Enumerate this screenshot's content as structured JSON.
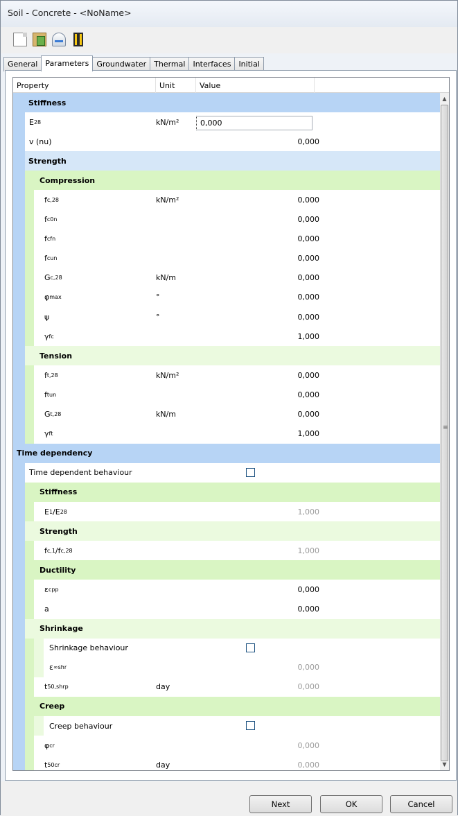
{
  "window": {
    "title": "Soil - Concrete - <NoName>"
  },
  "toolbar": [
    {
      "name": "new-document-icon"
    },
    {
      "name": "paste-icon"
    },
    {
      "name": "database-icon"
    },
    {
      "name": "book-icon"
    }
  ],
  "tabs": [
    {
      "label": "General",
      "active": false
    },
    {
      "label": "Parameters",
      "active": true
    },
    {
      "label": "Groundwater",
      "active": false
    },
    {
      "label": "Thermal",
      "active": false
    },
    {
      "label": "Interfaces",
      "active": false
    },
    {
      "label": "Initial",
      "active": false
    }
  ],
  "grid": {
    "headers": {
      "property": "Property",
      "unit": "Unit",
      "value": "Value"
    },
    "rows": [
      {
        "kind": "group1",
        "label": "Stiffness"
      },
      {
        "kind": "row",
        "level": 1,
        "base": "E",
        "sub": "28",
        "unit": "kN/m²",
        "value": "0,000",
        "edit": true
      },
      {
        "kind": "row",
        "level": 1,
        "base": "v (nu)",
        "value": "0,000"
      },
      {
        "kind": "group1",
        "label": "Strength",
        "light": true
      },
      {
        "kind": "group2",
        "label": "Compression"
      },
      {
        "kind": "row",
        "level": 2,
        "base": "f",
        "sub": "c,28",
        "unit": "kN/m²",
        "value": "0,000"
      },
      {
        "kind": "row",
        "level": 2,
        "base": "f",
        "sub": "c0n",
        "value": "0,000"
      },
      {
        "kind": "row",
        "level": 2,
        "base": "f",
        "sub": "cfn",
        "value": "0,000"
      },
      {
        "kind": "row",
        "level": 2,
        "base": "f",
        "sub": "cun",
        "value": "0,000"
      },
      {
        "kind": "row",
        "level": 2,
        "base": "G",
        "sub": "c,28",
        "unit": "kN/m",
        "value": "0,000"
      },
      {
        "kind": "row",
        "level": 2,
        "base": "φ",
        "sub": "max",
        "unit": "°",
        "value": "0,000"
      },
      {
        "kind": "row",
        "level": 2,
        "base": "ψ",
        "unit": "°",
        "value": "0,000"
      },
      {
        "kind": "row",
        "level": 2,
        "base": "γ",
        "sub": "fc",
        "value": "1,000"
      },
      {
        "kind": "group2",
        "label": "Tension",
        "light": true
      },
      {
        "kind": "row",
        "level": 2,
        "base": "f",
        "sub": "t,28",
        "unit": "kN/m²",
        "value": "0,000"
      },
      {
        "kind": "row",
        "level": 2,
        "base": "f",
        "sub": "tun",
        "value": "0,000"
      },
      {
        "kind": "row",
        "level": 2,
        "base": "G",
        "sub": "t,28",
        "unit": "kN/m",
        "value": "0,000"
      },
      {
        "kind": "row",
        "level": 2,
        "base": "γ",
        "sub": "ft",
        "value": "1,000"
      },
      {
        "kind": "group0",
        "label": "Time dependency"
      },
      {
        "kind": "row",
        "level": 1,
        "base": "Time dependent behaviour",
        "check": true
      },
      {
        "kind": "group2",
        "label": "Stiffness"
      },
      {
        "kind": "row",
        "level": 2,
        "base": "E",
        "sub": "1",
        "mid": "/E",
        "sub2": "28",
        "value": "1,000",
        "disabled": true
      },
      {
        "kind": "group2",
        "label": "Strength",
        "light": true
      },
      {
        "kind": "row",
        "level": 2,
        "base": "f",
        "sub": "c,1",
        "mid": "/f",
        "sub2": "c,28",
        "value": "1,000",
        "disabled": true
      },
      {
        "kind": "group2",
        "label": "Ductility"
      },
      {
        "kind": "row",
        "level": 2,
        "base": "ε",
        "sub": "cp",
        "sup": "p",
        "value": "0,000"
      },
      {
        "kind": "row",
        "level": 2,
        "base": "a",
        "value": "0,000"
      },
      {
        "kind": "group2",
        "label": "Shrinkage",
        "light": true
      },
      {
        "kind": "row",
        "level": 3,
        "base": "Shrinkage behaviour",
        "check": true
      },
      {
        "kind": "row",
        "level": 3,
        "base": "ε",
        "sub": "∞",
        "sup": "shr",
        "value": "0,000",
        "disabled": true
      },
      {
        "kind": "row",
        "level": 2,
        "base": "t",
        "sub": "50,shr",
        "sup": "p",
        "unit": "day",
        "value": "0,000",
        "disabled": true
      },
      {
        "kind": "group2",
        "label": "Creep"
      },
      {
        "kind": "row",
        "level": 3,
        "base": "Creep behaviour",
        "check": true
      },
      {
        "kind": "row",
        "level": 2,
        "base": "φ",
        "sup": "cr",
        "value": "0,000",
        "disabled": true
      },
      {
        "kind": "row",
        "level": 2,
        "base": "t",
        "sub": "50",
        "sup": "cr",
        "unit": "day",
        "value": "0,000",
        "disabled": true
      }
    ]
  },
  "buttons": {
    "next": "Next",
    "ok": "OK",
    "cancel": "Cancel"
  },
  "colors": {
    "group_blue": "#b7d4f5",
    "group_blue_light": "#d6e7f8",
    "group_green": "#d9f5c3",
    "group_green_light": "#ebfadf",
    "stripe_blue": "#b7d4f5",
    "stripe_green": "#d9f5c3"
  }
}
